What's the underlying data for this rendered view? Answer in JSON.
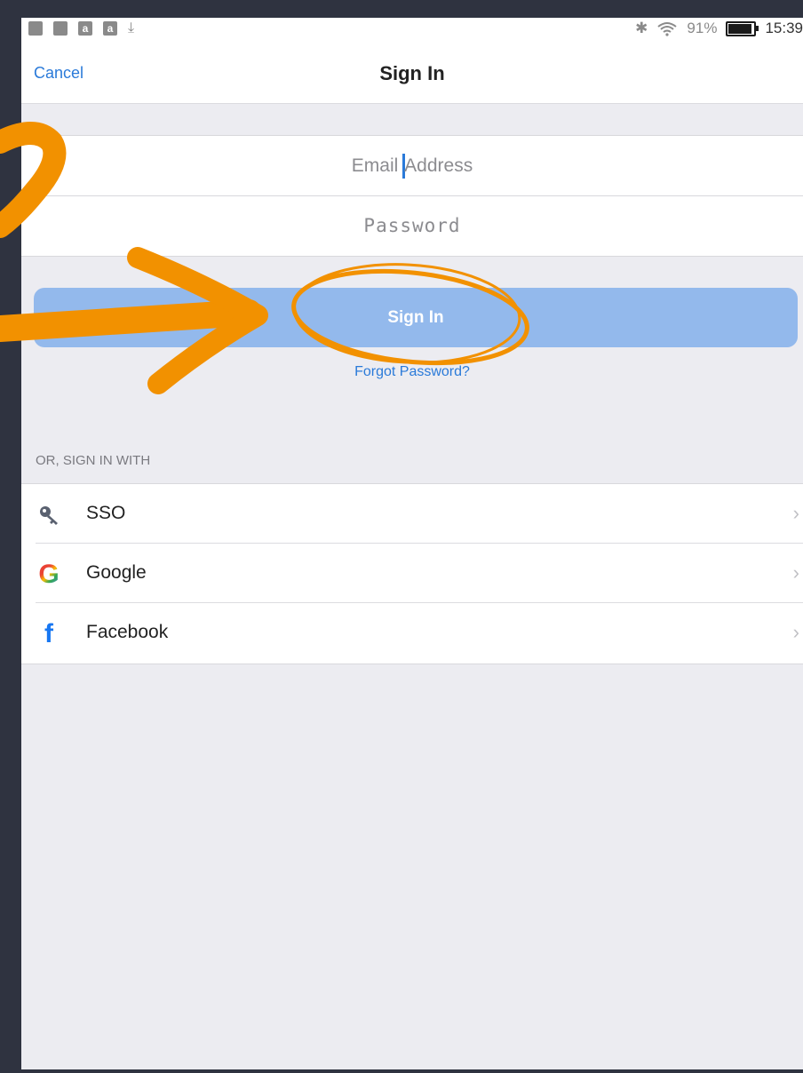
{
  "status_bar": {
    "left_icons": [
      "book-icon",
      "image-icon",
      "amazon-icon",
      "amazon-icon",
      "download-icon"
    ],
    "amazon_letter": "a",
    "download_glyph": "⤓",
    "bluetooth_glyph": "✱",
    "battery_percent": "91%",
    "time": "15:39"
  },
  "nav": {
    "cancel_label": "Cancel",
    "title": "Sign In"
  },
  "form": {
    "email_placeholder_before": "Email ",
    "email_placeholder_after": "ddress",
    "email_cursor_letter": "A",
    "password_placeholder": "Password",
    "signin_label": "Sign In",
    "forgot_label": "Forgot Password?"
  },
  "alt_signin": {
    "header": "OR, SIGN IN WITH",
    "items": [
      {
        "label": "SSO",
        "icon": "key-icon"
      },
      {
        "label": "Google",
        "icon": "google-icon"
      },
      {
        "label": "Facebook",
        "icon": "facebook-icon"
      }
    ],
    "chevron": "›",
    "google_glyph": "G",
    "facebook_glyph": "f"
  },
  "colors": {
    "accent": "#2a7ad9",
    "button": "#93b9ec",
    "annotation": "#f29100"
  }
}
